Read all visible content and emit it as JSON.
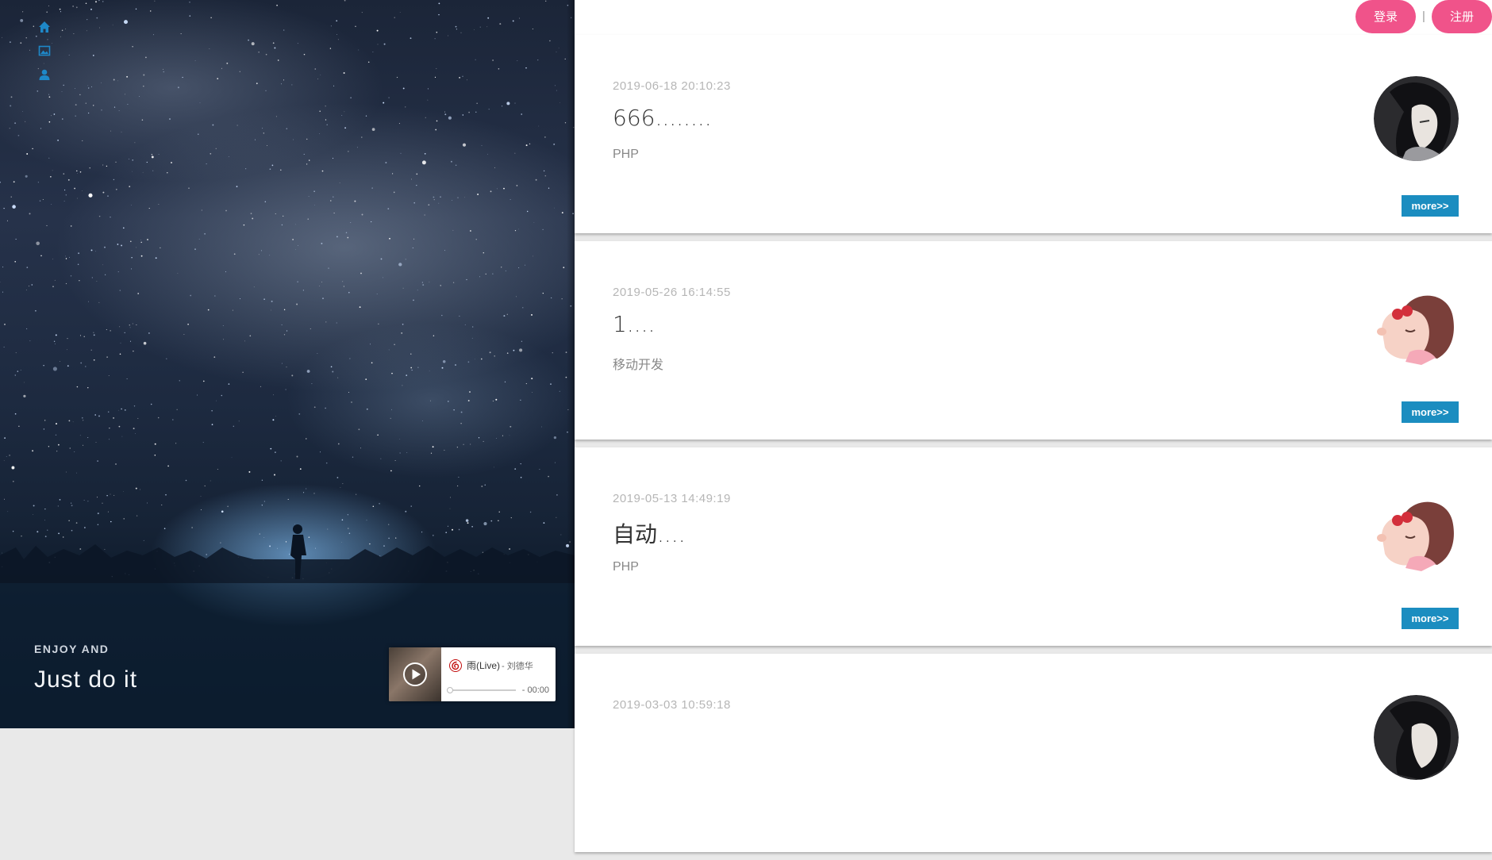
{
  "sidebar": {
    "icons": [
      "home-icon",
      "image-icon",
      "user-icon"
    ],
    "accent": "#1e88c8"
  },
  "hero": {
    "eyebrow": "ENJOY AND",
    "tagline": "Just do it"
  },
  "player": {
    "track_title": "雨(Live)",
    "artist": " - 刘德华",
    "time": "- 00:00",
    "progress": 0
  },
  "topbar": {
    "login_label": "登录",
    "separator": "|",
    "register_label": "注册",
    "accent": "#f0538a"
  },
  "posts": [
    {
      "date": "2019-06-18 20:10:23",
      "title": "666........",
      "category": "PHP",
      "avatar": "dark-hair-avatar",
      "more_label": "more>>"
    },
    {
      "date": "2019-05-26 16:14:55",
      "title": "1....",
      "category": "移动开发",
      "avatar": "cartoon-girl-avatar",
      "more_label": "more>>"
    },
    {
      "date": "2019-05-13 14:49:19",
      "title": "自动....",
      "category": "PHP",
      "avatar": "cartoon-girl-avatar",
      "more_label": "more>>"
    },
    {
      "date": "2019-03-03 10:59:18",
      "title": "",
      "category": "",
      "avatar": "dark-hair-avatar",
      "more_label": ""
    }
  ],
  "more_button_color": "#1b8dc0"
}
